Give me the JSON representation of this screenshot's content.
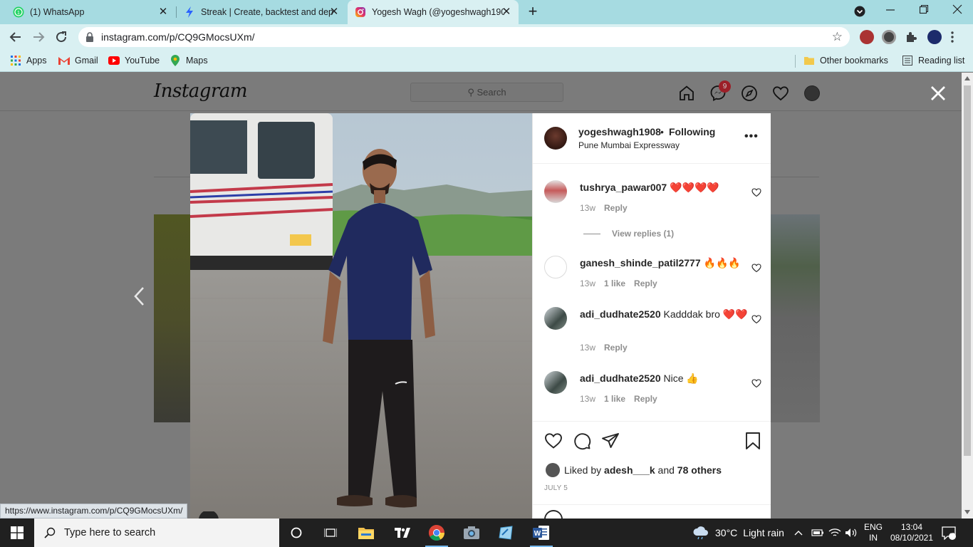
{
  "browser": {
    "tabs": [
      {
        "title": "(1) WhatsApp",
        "icon": "whatsapp-icon"
      },
      {
        "title": "Streak | Create, backtest and dep",
        "icon": "streak-icon"
      },
      {
        "title": "Yogesh Wagh (@yogeshwagh190",
        "icon": "instagram-icon"
      }
    ],
    "url": "instagram.com/p/CQ9GMocsUXm/",
    "bookmarks": {
      "apps": "Apps",
      "gmail": "Gmail",
      "youtube": "YouTube",
      "maps": "Maps",
      "other": "Other bookmarks",
      "reading": "Reading list"
    },
    "status_url": "https://www.instagram.com/p/CQ9GMocsUXm/"
  },
  "instagram": {
    "logo": "Instagram",
    "search_placeholder": "Search",
    "messenger_badge": "9"
  },
  "post": {
    "username": "yogeshwagh1908",
    "separator": "•",
    "following": "Following",
    "location": "Pune Mumbai Expressway",
    "comments": [
      {
        "user": "tushrya_pawar007",
        "text": "❤️❤️❤️❤️",
        "age": "13w",
        "likes": "",
        "reply": "Reply"
      },
      {
        "user": "ganesh_shinde_patil2777",
        "text": "🔥🔥🔥",
        "age": "13w",
        "likes": "1 like",
        "reply": "Reply"
      },
      {
        "user": "adi_dudhate2520",
        "text": "Kadddak bro ❤️❤️",
        "age": "13w",
        "likes": "",
        "reply": "Reply"
      },
      {
        "user": "adi_dudhate2520",
        "text": "Nice 👍",
        "age": "13w",
        "likes": "1 like",
        "reply": "Reply"
      }
    ],
    "view_replies": "View replies (1)",
    "liked_by_prefix": "Liked by",
    "liked_by_user": "adesh___k",
    "liked_by_and": "and",
    "liked_by_others": "78 others",
    "date": "JULY 5"
  },
  "taskbar": {
    "search_placeholder": "Type here to search",
    "weather_temp": "30°C",
    "weather_desc": "Light rain",
    "lang_top": "ENG",
    "lang_bottom": "IN",
    "time": "13:04",
    "date": "08/10/2021",
    "notification_count": "7"
  },
  "colors": {
    "tab_strip": "#a6dbe1",
    "toolbar": "#d9f0f2",
    "overlay": "#7b7b7b",
    "heart_red": "#ed4956",
    "taskbar": "#202020"
  }
}
